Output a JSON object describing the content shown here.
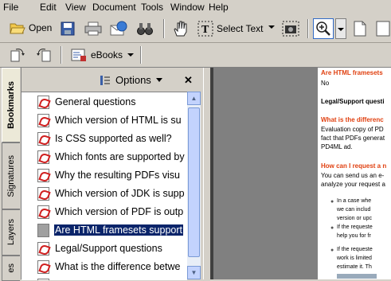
{
  "menubar": {
    "items": [
      "File",
      "Edit",
      "View",
      "Document",
      "Tools",
      "Window",
      "Help"
    ]
  },
  "toolbar1": {
    "open_label": "Open",
    "select_text_label": "Select Text"
  },
  "toolbar2": {
    "ebooks_label": "eBooks"
  },
  "nav_tabs": [
    "Bookmarks",
    "Signatures",
    "Layers",
    "es"
  ],
  "bookmarks_panel": {
    "options_label": "Options",
    "close_glyph": "✕",
    "items": [
      {
        "label": "General questions",
        "selected": false
      },
      {
        "label": "Which version of HTML is su",
        "selected": false
      },
      {
        "label": "Is CSS supported as well?",
        "selected": false
      },
      {
        "label": "Which fonts are supported by",
        "selected": false
      },
      {
        "label": "Why the resulting PDFs visu",
        "selected": false
      },
      {
        "label": "Which version of JDK is supp",
        "selected": false
      },
      {
        "label": "Which version of PDF is outp",
        "selected": false
      },
      {
        "label": "Are HTML framesets support",
        "selected": true
      },
      {
        "label": "Legal/Support questions",
        "selected": false
      },
      {
        "label": "What is the difference betwe",
        "selected": false
      }
    ]
  },
  "document": {
    "lines": [
      {
        "text": "Are HTML framesets",
        "style": "red"
      },
      {
        "text": "No",
        "style": "normal"
      },
      {
        "text": "Legal/Support questi",
        "style": "bold"
      },
      {
        "text": "What is the differenc",
        "style": "red"
      },
      {
        "text": "Evaluation copy of PD",
        "style": "normal"
      },
      {
        "text": "fact that PDFs generat",
        "style": "normal"
      },
      {
        "text": "PD4ML ad.",
        "style": "normal"
      },
      {
        "text": "How can I request a n",
        "style": "red"
      },
      {
        "text": "You can send us an e-",
        "style": "normal"
      },
      {
        "text": "analyze your request a",
        "style": "normal"
      },
      {
        "text": "In a case whe",
        "style": "ind"
      },
      {
        "text": "we can includ",
        "style": "ind2"
      },
      {
        "text": "version or upc",
        "style": "ind2"
      },
      {
        "text": "If the requeste",
        "style": "ind"
      },
      {
        "text": "help you for fr",
        "style": "ind2"
      },
      {
        "text": "If the requeste",
        "style": "ind"
      },
      {
        "text": "work is limited",
        "style": "ind2"
      },
      {
        "text": "estimate it. Th",
        "style": "ind2"
      },
      {
        "text": "",
        "style": "ind2"
      }
    ]
  },
  "colors": {
    "selection": "#0a246a",
    "heading_red": "#e04010",
    "chrome": "#d4d0c8"
  }
}
